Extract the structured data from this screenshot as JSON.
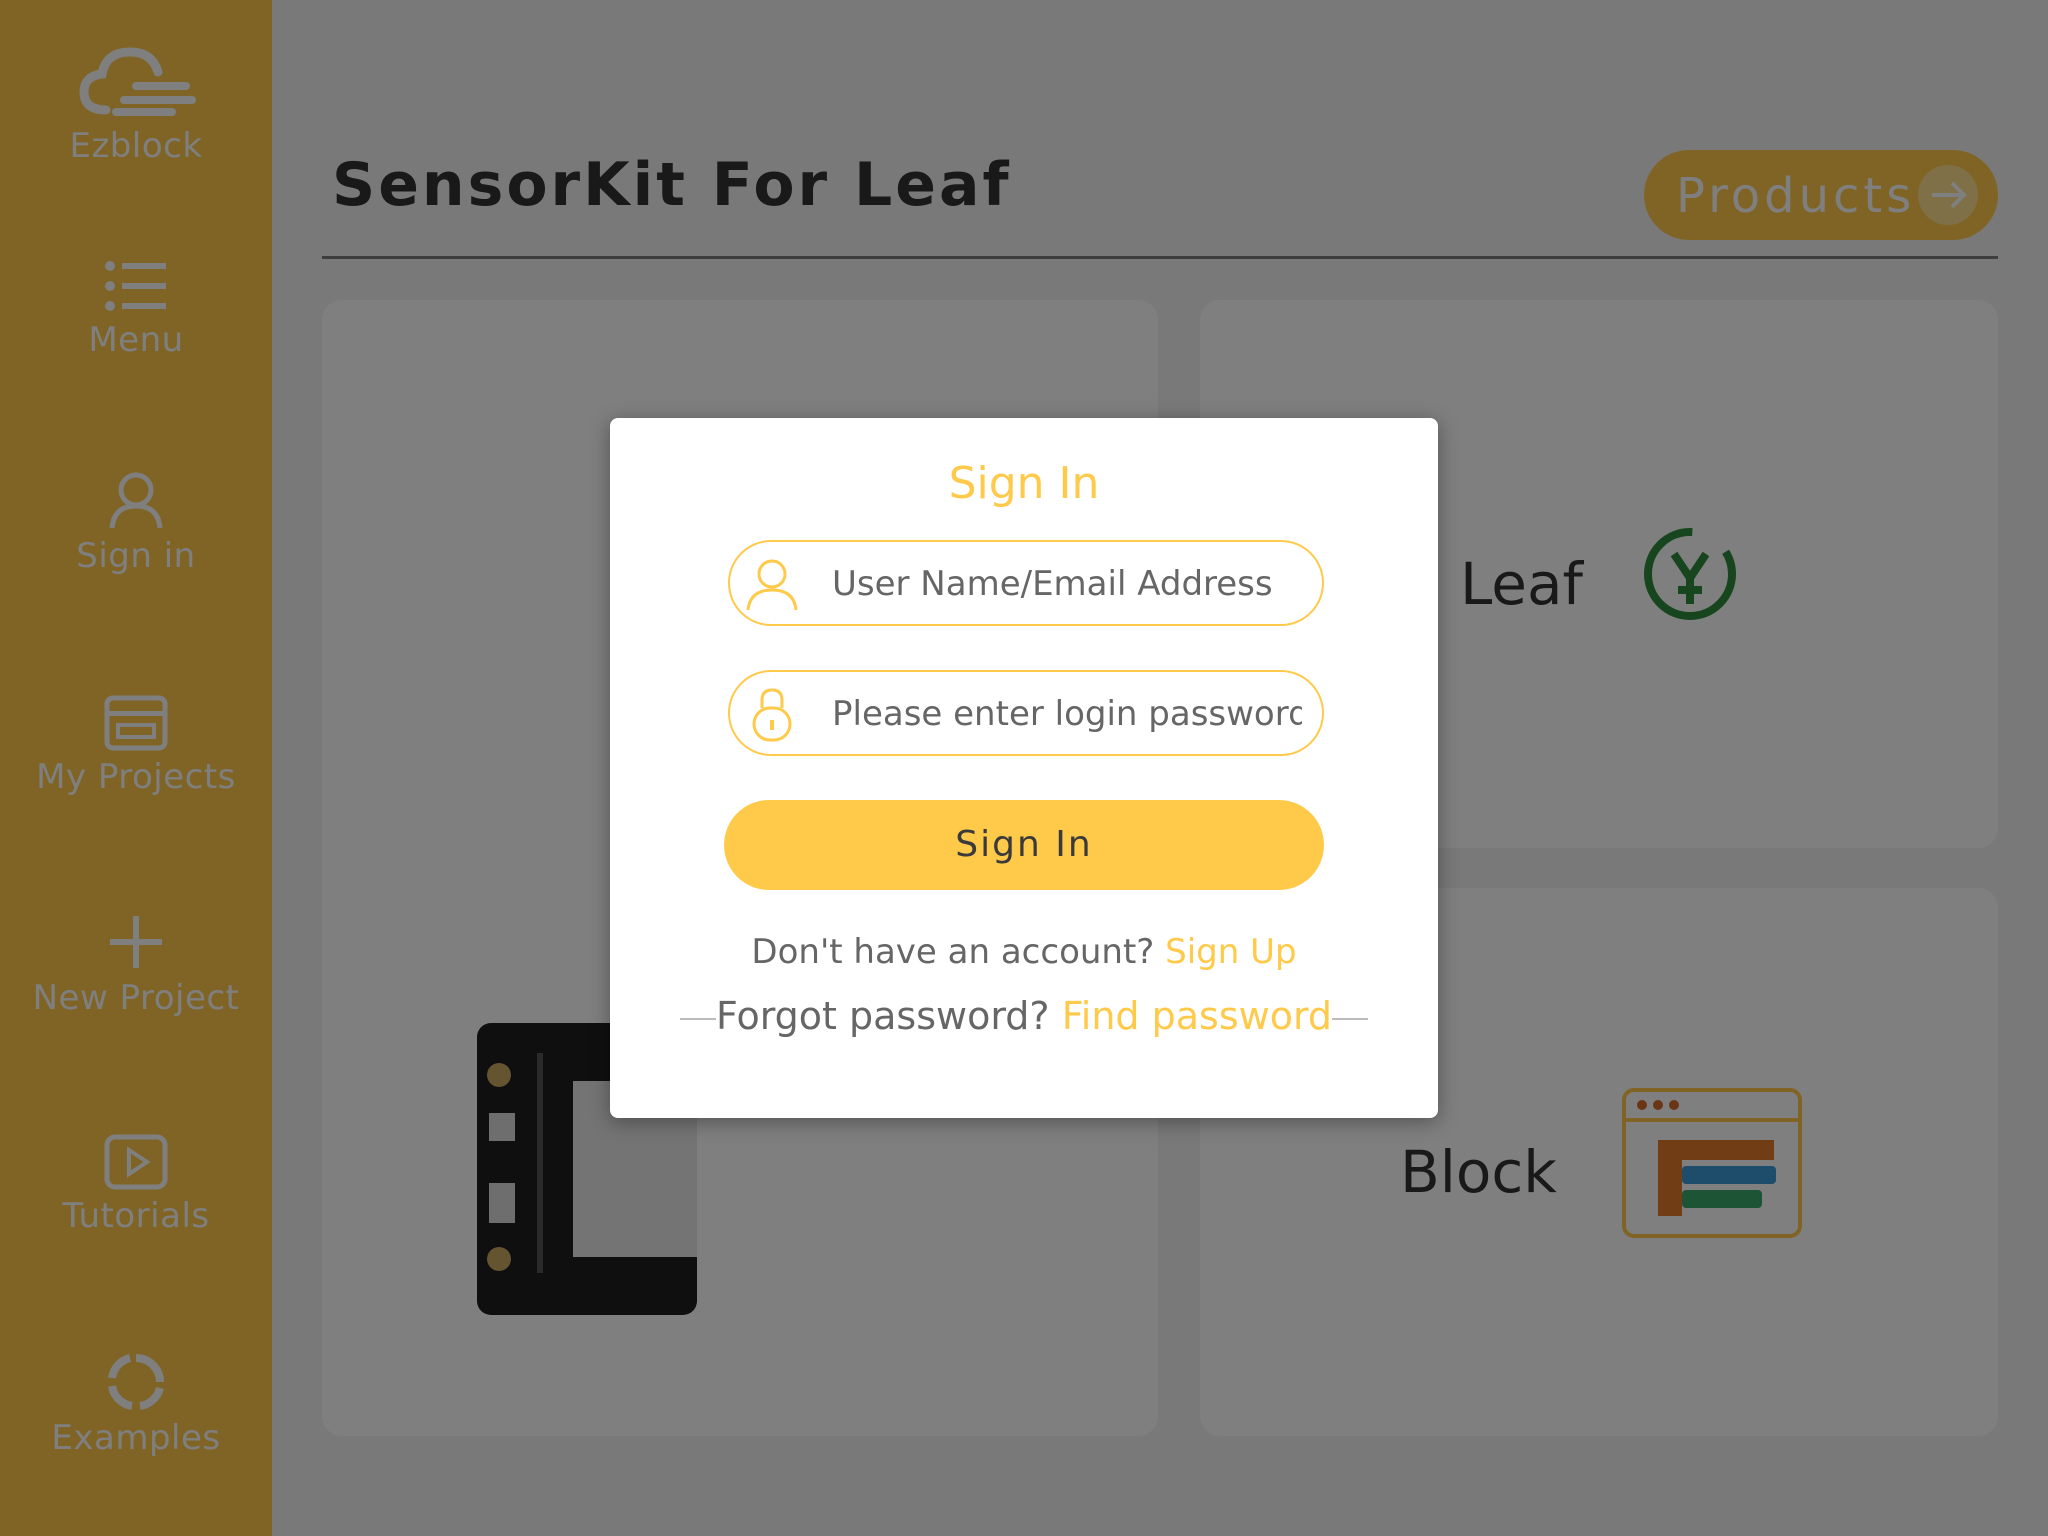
{
  "sidebar": {
    "items": [
      {
        "label": "Ezblock",
        "icon": "cloud-logo-icon"
      },
      {
        "label": "Menu",
        "icon": "list-icon"
      },
      {
        "label": "Sign in",
        "icon": "user-icon"
      },
      {
        "label": "My Projects",
        "icon": "projects-icon"
      },
      {
        "label": "New Project",
        "icon": "plus-icon"
      },
      {
        "label": "Tutorials",
        "icon": "play-icon"
      },
      {
        "label": "Examples",
        "icon": "examples-icon"
      }
    ]
  },
  "main": {
    "title": "SensorKit For Leaf",
    "products_label": "Products",
    "cards": {
      "leaf_label": "Leaf",
      "block_label": "Block"
    }
  },
  "dialog": {
    "title": "Sign In",
    "username_placeholder": "User Name/Email Address",
    "password_placeholder": "Please enter login password",
    "submit_label": "Sign In",
    "no_account_text": "Don't have an account?",
    "sign_up_link": "Sign Up",
    "forgot_text": "Forgot password?",
    "find_password_link": "Find password"
  },
  "colors": {
    "accent": "#FFC94A",
    "overlay": "rgba(0,0,0,0.5)"
  }
}
